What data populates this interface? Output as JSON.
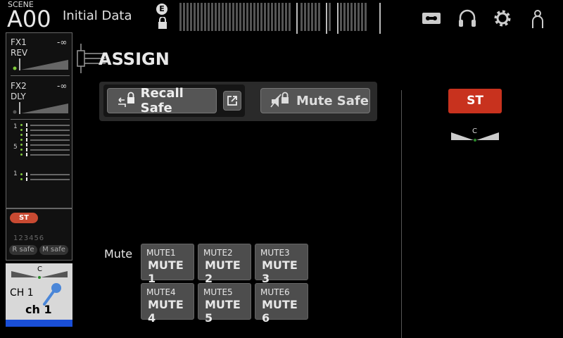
{
  "scene": {
    "label": "SCENE",
    "number": "A00",
    "title": "Initial Data"
  },
  "topbar": {
    "badge_e": "E"
  },
  "fx": [
    {
      "name1": "FX1",
      "name2": "REV",
      "level": "-∞"
    },
    {
      "name1": "FX2",
      "name2": "DLY",
      "level": "-∞"
    }
  ],
  "mix_labels": {
    "a": "1",
    "b": "5",
    "c": "1"
  },
  "stereo": {
    "pill": "ST",
    "numbers": "123456",
    "rsafe": "R safe",
    "msafe": "M safe"
  },
  "channel": {
    "pan": "C",
    "name": "CH 1",
    "label": "ch 1"
  },
  "page_title": "ASSIGN",
  "buttons": {
    "recall_safe": "Recall Safe",
    "mute_safe": "Mute Safe"
  },
  "mute": {
    "label": "Mute",
    "groups": [
      {
        "small": "MUTE1",
        "large": "MUTE 1"
      },
      {
        "small": "MUTE2",
        "large": "MUTE 2"
      },
      {
        "small": "MUTE3",
        "large": "MUTE 3"
      },
      {
        "small": "MUTE4",
        "large": "MUTE 4"
      },
      {
        "small": "MUTE5",
        "large": "MUTE 5"
      },
      {
        "small": "MUTE6",
        "large": "MUTE 6"
      }
    ]
  },
  "st": {
    "label": "ST",
    "pan": "C"
  },
  "colors": {
    "accent_red": "#c8321e",
    "meter_green": "#7ec83a",
    "channel_bar": "#1a4fd8"
  }
}
